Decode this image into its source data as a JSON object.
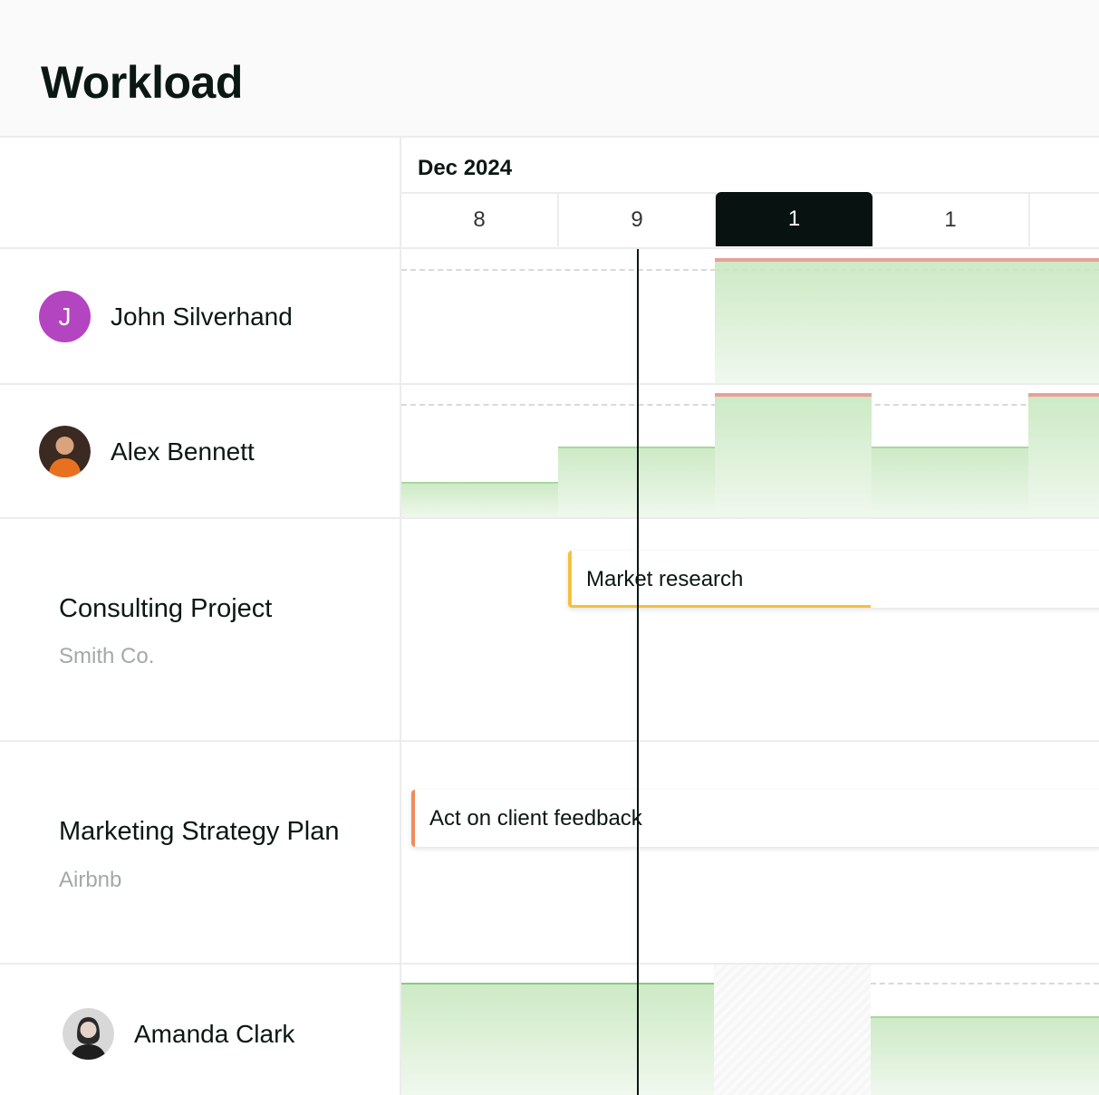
{
  "header": {
    "title": "Workload"
  },
  "timeline": {
    "month": "Dec 2024",
    "days": [
      "8",
      "9",
      "1",
      "1"
    ],
    "active_day_index": 2
  },
  "people": [
    {
      "name": "John Silverhand",
      "initial": "J",
      "avatar_color": "#b445c1"
    },
    {
      "name": "Alex Bennett"
    },
    {
      "name": "Amanda Clark"
    }
  ],
  "projects": [
    {
      "name": "Consulting Project",
      "client": "Smith Co.",
      "task": "Market research",
      "task_color": "#f2c23a"
    },
    {
      "name": "Marketing Strategy Plan",
      "client": "Airbnb",
      "task": "Act on client feedback",
      "task_color": "#f08c5a"
    }
  ],
  "colors": {
    "workload_fill": "#cdeac5",
    "over_capacity": "#e7a19a",
    "active_day": "#081311"
  }
}
